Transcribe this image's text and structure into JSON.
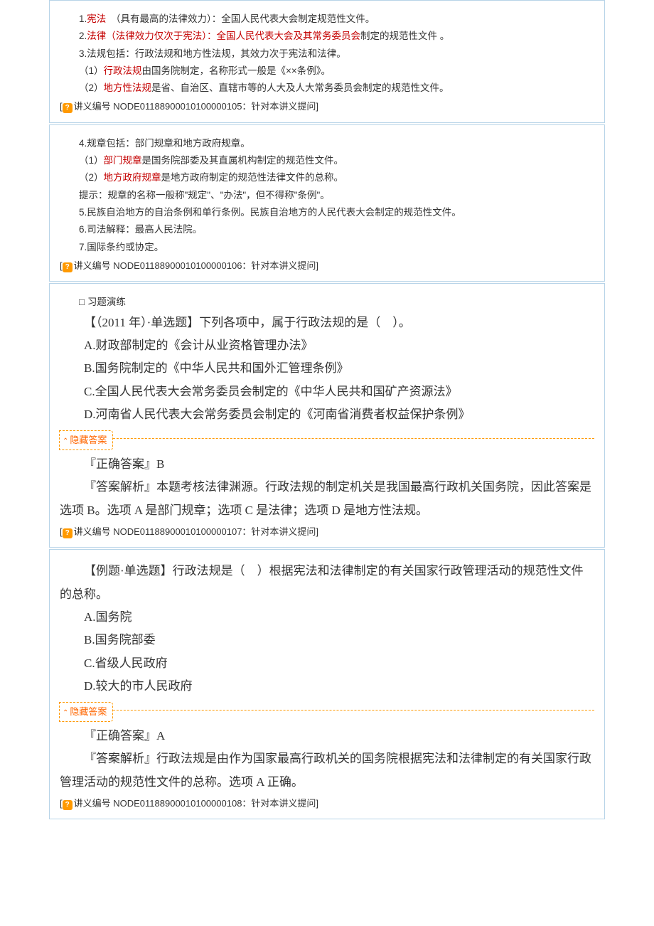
{
  "s1": {
    "l1a": "1.",
    "l1b": "宪法",
    "l1c": "（具有最高的法律效力）：全国人民代表大会制定规范性文件。",
    "l2a": "2.",
    "l2b": "法律（法律效力仅次于宪法）：全国人民代表大会及其常务委员会",
    "l2c": "制定的规范性文件 。",
    "l3": "3.法规包括：行政法规和地方性法规，其效力次于宪法和法律。",
    "l4a": "（1）",
    "l4b": "行政法规",
    "l4c": "由国务院制定，名称形式一般是《××条例》。",
    "l5a": "（2）",
    "l5b": "地方性法规",
    "l5c": "是省、自治区、直辖市等的人大及人大常务委员会制定的规范性文件。",
    "note": "讲义编号 NODE01188900010100000105：针对本讲义提问]"
  },
  "s2": {
    "l1": "4.规章包括：部门规章和地方政府规章。",
    "l2a": "（1）",
    "l2b": "部门规章",
    "l2c": "是国务院部委及其直属机构制定的规范性文件。",
    "l3a": "（2）",
    "l3b": "地方政府规章",
    "l3c": "是地方政府制定的规范性法律文件的总称。",
    "l4": "提示：规章的名称一般称\"规定\"、\"办法\"，但不得称\"条例\"。",
    "l5": "5.民族自治地方的自治条例和单行条例。民族自治地方的人民代表大会制定的规范性文件。",
    "l6": "6.司法解释：最高人民法院。",
    "l7": "7.国际条约或协定。",
    "note": "讲义编号 NODE01188900010100000106：针对本讲义提问]"
  },
  "s3": {
    "drill": "□ 习题演练",
    "q": "【（2011 年）·单选题】下列各项中，属于行政法规的是（　）。",
    "a": "A.财政部制定的《会计从业资格管理办法》",
    "b": "B.国务院制定的《中华人民共和国外汇管理条例》",
    "c": "C.全国人民代表大会常务委员会制定的《中华人民共和国矿产资源法》",
    "d": "D.河南省人民代表大会常务委员会制定的《河南省消费者权益保护条例》",
    "hide": "隐藏答案",
    "ans": "『正确答案』B",
    "exp": "『答案解析』本题考核法律渊源。行政法规的制定机关是我国最高行政机关国务院，因此答案是选项 B。选项 A 是部门规章；选项 C 是法律；选项 D 是地方性法规。",
    "note": "讲义编号 NODE01188900010100000107：针对本讲义提问]"
  },
  "s4": {
    "q": "【例题·单选题】行政法规是（　）根据宪法和法律制定的有关国家行政管理活动的规范性文件的总称。",
    "a": "A.国务院",
    "b": "B.国务院部委",
    "c": "C.省级人民政府",
    "d": "D.较大的市人民政府",
    "hide": "隐藏答案",
    "ans": "『正确答案』A",
    "exp": "『答案解析』行政法规是由作为国家最高行政机关的国务院根据宪法和法律制定的有关国家行政管理活动的规范性文件的总称。选项 A 正确。",
    "note": "讲义编号 NODE01188900010100000108：针对本讲义提问]"
  }
}
